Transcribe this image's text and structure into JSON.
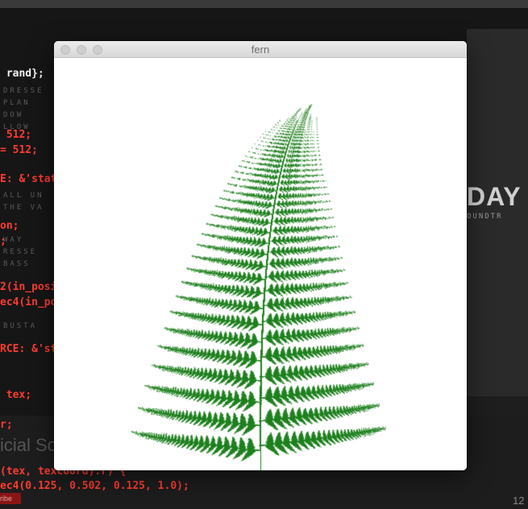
{
  "window": {
    "title": "fern",
    "controls": [
      "close-button",
      "minimize-button",
      "zoom-button"
    ]
  },
  "canvas": {
    "fill_color": "#208020",
    "background": "#ffffff"
  },
  "background_editor": {
    "lines": [
      {
        "text": " rand};",
        "color": "#f2f2f2"
      },
      {
        "text": " 512;",
        "color": "#ff3b30"
      },
      {
        "text": "= 512;",
        "color": "#ff3b30"
      },
      {
        "text": "E: &'stat",
        "color": "#ff3b30"
      },
      {
        "text": "on;",
        "color": "#ff3b30"
      },
      {
        "text": ";",
        "color": "#ff3b30"
      },
      {
        "text": "2(in_posi",
        "color": "#ff3b30"
      },
      {
        "text": "ec4(in_po",
        "color": "#ff3b30"
      },
      {
        "text": "RCE: &'st",
        "color": "#ff3b30"
      },
      {
        "text": " tex;",
        "color": "#ff3b30"
      },
      {
        "text": "r;",
        "color": "#ff3b30"
      },
      {
        "text": "(tex, texcoord).r) {",
        "color": "#ff3b30"
      },
      {
        "text": "ec4(0.125, 0.502, 0.125, 1.0);",
        "color": "#ff3b30"
      }
    ],
    "lower_title": "icial Sou",
    "tag": "ribe",
    "page_number": "12",
    "video_title": "DAY",
    "video_subtitle": "OUNDTR"
  }
}
